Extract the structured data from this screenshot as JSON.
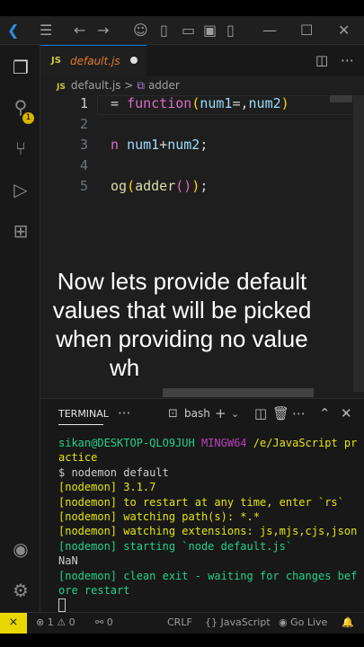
{
  "colors": {
    "keyword": "#569cd6",
    "function_kw": "#d86cc2",
    "function_name": "#dcdcaa",
    "variable": "#9cdcfe",
    "operator": "#d4d4d4",
    "prompt_user": "#23d18b",
    "prompt_host": "#bc3fbc",
    "prompt_path": "#e5e510",
    "nodemon": "#23d18b",
    "status_remote": "#e9d700"
  },
  "titlebar": {
    "icons": [
      "vscode-logo-icon",
      "menu-icon",
      "back-icon",
      "forward-icon",
      "copilot-icon",
      "toggle-sidebar-icon",
      "toggle-panel-icon",
      "customize-layout-icon",
      "minimize-icon",
      "maximize-icon",
      "close-icon"
    ]
  },
  "activity": {
    "badge": "1",
    "icons": [
      "explorer-icon",
      "search-icon",
      "source-control-icon",
      "run-debug-icon",
      "extensions-icon",
      "account-icon",
      "settings-gear-icon"
    ]
  },
  "editor": {
    "tab": {
      "lang": "JS",
      "filename": "default.js"
    },
    "breadcrumb": {
      "file": "default.js",
      "separator": ">",
      "symbol": "adder"
    },
    "lines": [
      {
        "no": "1",
        "tokens": [
          {
            "t": "= ",
            "c": "#d4d4d4"
          },
          {
            "t": "function",
            "c": "#d86cc2"
          },
          {
            "t": "(",
            "c": "#ffd700"
          },
          {
            "t": "num1",
            "c": "#9cdcfe"
          },
          {
            "t": "=",
            "c": "#d4d4d4"
          },
          {
            "t": ",",
            "c": "#d4d4d4"
          },
          {
            "t": "num2",
            "c": "#9cdcfe"
          },
          {
            "t": ")",
            "c": "#ffd700"
          }
        ]
      },
      {
        "no": "2",
        "tokens": []
      },
      {
        "no": "3",
        "tokens": [
          {
            "t": "n ",
            "c": "#d86cc2"
          },
          {
            "t": "num1",
            "c": "#9cdcfe"
          },
          {
            "t": "+",
            "c": "#d4d4d4"
          },
          {
            "t": "num2",
            "c": "#9cdcfe"
          },
          {
            "t": ";",
            "c": "#d4d4d4"
          }
        ]
      },
      {
        "no": "4",
        "tokens": []
      },
      {
        "no": "5",
        "tokens": [
          {
            "t": "og",
            "c": "#dcdcaa"
          },
          {
            "t": "(",
            "c": "#ffd700"
          },
          {
            "t": "adder",
            "c": "#dcdcaa"
          },
          {
            "t": "()",
            "c": "#d86cc2"
          },
          {
            "t": ")",
            "c": "#ffd700"
          },
          {
            "t": ";",
            "c": "#d4d4d4"
          }
        ]
      }
    ]
  },
  "caption": [
    "Now lets provide default",
    "values that will be picked",
    "when providing no value",
    "wh"
  ],
  "panel": {
    "title": "TERMINAL",
    "more": "···",
    "shell": "bash",
    "terminal_lines": [
      {
        "segs": [
          {
            "t": "sikan@DESKTOP-QLO9JUH ",
            "c": "#23d18b"
          },
          {
            "t": "MINGW64 ",
            "c": "#bc3fbc"
          },
          {
            "t": "/e/JavaScript practice",
            "c": "#e5e510"
          }
        ]
      },
      {
        "segs": [
          {
            "t": "$ nodemon default",
            "c": "#cccccc"
          }
        ]
      },
      {
        "segs": [
          {
            "t": "[nodemon] 3.1.7",
            "c": "#e5e510"
          }
        ]
      },
      {
        "segs": [
          {
            "t": "[nodemon] to restart at any time, enter `rs`",
            "c": "#e5e510"
          }
        ]
      },
      {
        "segs": [
          {
            "t": "[nodemon] watching path(s): *.*",
            "c": "#e5e510"
          }
        ]
      },
      {
        "segs": [
          {
            "t": "[nodemon] watching extensions: js,mjs,cjs,json",
            "c": "#e5e510"
          }
        ]
      },
      {
        "segs": [
          {
            "t": "[nodemon] starting `node default.js`",
            "c": "#23d18b"
          }
        ]
      },
      {
        "segs": [
          {
            "t": "NaN",
            "c": "#cccccc"
          }
        ]
      },
      {
        "segs": [
          {
            "t": "[nodemon] clean exit - waiting for changes before restart",
            "c": "#23d18b"
          }
        ]
      }
    ]
  },
  "statusbar": {
    "remote": "⨯",
    "errors": "1",
    "warnings": "0",
    "ports": "0",
    "eol": "CRLF",
    "language": "JavaScript",
    "golive": "Go Live"
  }
}
